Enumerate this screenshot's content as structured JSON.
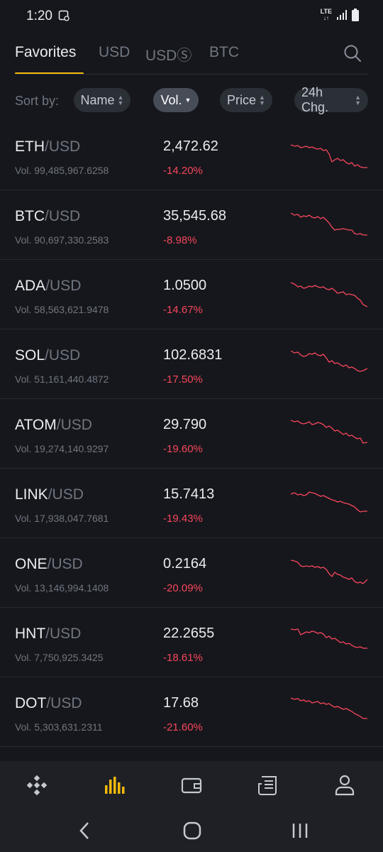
{
  "status": {
    "time": "1:20",
    "network": "LTE"
  },
  "tabs": [
    {
      "label": "Favorites"
    },
    {
      "label": "USD"
    },
    {
      "label": "USDⓈ"
    },
    {
      "label": "BTC"
    }
  ],
  "sort": {
    "label": "Sort by:",
    "chips": [
      {
        "label": "Name"
      },
      {
        "label": "Vol."
      },
      {
        "label": "Price"
      },
      {
        "label": "24h Chg."
      }
    ]
  },
  "markets": [
    {
      "base": "ETH",
      "quote": "/USD",
      "volume": "Vol. 99,485,967.6258",
      "price": "2,472.62",
      "change": "-14.20%"
    },
    {
      "base": "BTC",
      "quote": "/USD",
      "volume": "Vol. 90,697,330.2583",
      "price": "35,545.68",
      "change": "-8.98%"
    },
    {
      "base": "ADA",
      "quote": "/USD",
      "volume": "Vol. 58,563,621.9478",
      "price": "1.0500",
      "change": "-14.67%"
    },
    {
      "base": "SOL",
      "quote": "/USD",
      "volume": "Vol. 51,161,440.4872",
      "price": "102.6831",
      "change": "-17.50%"
    },
    {
      "base": "ATOM",
      "quote": "/USD",
      "volume": "Vol. 19,274,140.9297",
      "price": "29.790",
      "change": "-19.60%"
    },
    {
      "base": "LINK",
      "quote": "/USD",
      "volume": "Vol. 17,938,047.7681",
      "price": "15.7413",
      "change": "-19.43%"
    },
    {
      "base": "ONE",
      "quote": "/USD",
      "volume": "Vol. 13,146,994.1408",
      "price": "0.2164",
      "change": "-20.09%"
    },
    {
      "base": "HNT",
      "quote": "/USD",
      "volume": "Vol. 7,750,925.3425",
      "price": "22.2655",
      "change": "-18.61%"
    },
    {
      "base": "DOT",
      "quote": "/USD",
      "volume": "Vol. 5,303,631.2311",
      "price": "17.68",
      "change": "-21.60%"
    }
  ],
  "nav": {
    "items": [
      "home-icon",
      "markets-icon",
      "wallet-icon",
      "news-icon",
      "profile-icon"
    ],
    "active": "markets-icon"
  },
  "colors": {
    "accent": "#f0b90b",
    "negative": "#f6465d",
    "background": "#16171c"
  }
}
